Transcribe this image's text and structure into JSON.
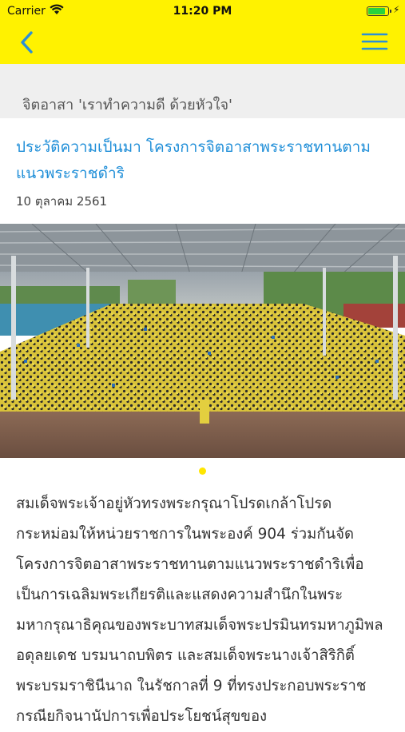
{
  "status_bar": {
    "carrier": "Carrier",
    "time": "11:20 PM",
    "battery_level": 0.92
  },
  "header": {
    "background": "#fff200",
    "back_icon": "chevron-left-icon",
    "menu_icon": "hamburger-menu-icon",
    "icon_color": "#2b8fd6"
  },
  "section": {
    "title": "จิตอาสา 'เราทำความดี ด้วยหัวใจ'"
  },
  "article": {
    "title": "ประวัติความเป็นมา โครงการจิตอาสาพระราชทานตามแนวพระราชดำริ",
    "date": "10 ตุลาคม 2561",
    "title_color": "#1e8ed8",
    "carousel": {
      "current_index": 1,
      "total": 1,
      "dot_color": "#ffe600"
    },
    "body": "สมเด็จพระเจ้าอยู่หัวทรงพระกรุณาโปรดเกล้าโปรดกระหม่อมให้หน่วยราชการในพระองค์ 904 ร่วมกันจัดโครงการจิตอาสาพระราชทานตามแนวพระราชดำริเพื่อเป็นการเฉลิมพระเกียรติและแสดงความสำนึกในพระมหากรุณาธิคุณของพระบาทสมเด็จพระปรมินทรมหาภูมิพลอดุลยเดช บรมนาถบพิตร และสมเด็จพระนางเจ้าสิริกิติ์ พระบรมราชินีนาถ ในรัชกาลที่ 9 ที่ทรงประกอบพระราชกรณียกิจนานัปการเพื่อประโยชน์สุขของ"
  }
}
